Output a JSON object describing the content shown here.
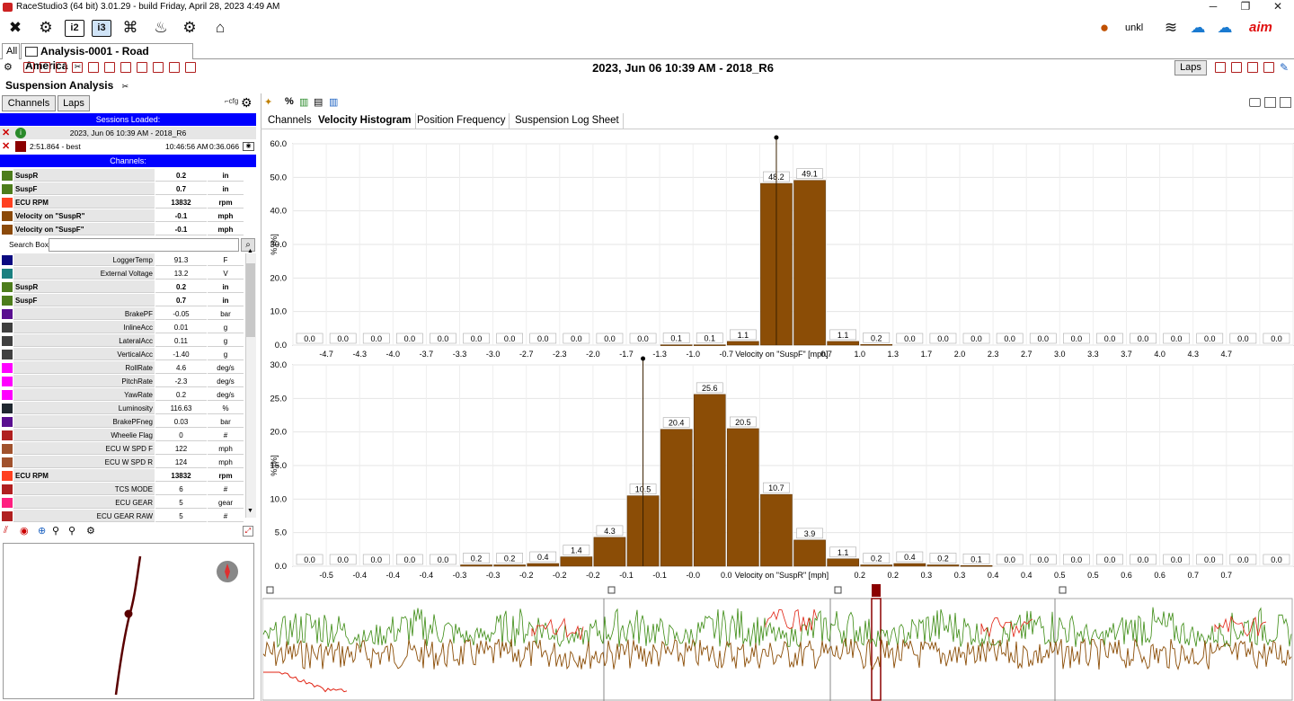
{
  "window": {
    "title": "RaceStudio3 (64 bit) 3.01.29 - build Friday, April 28, 2023 4:49 AM",
    "user": "unkl"
  },
  "tabs": {
    "all": "All",
    "analysis": "Analysis-0001 - Road America"
  },
  "header": {
    "session_title": "2023, Jun 06 10:39 AM - 2018_R6",
    "laps_button": "Laps"
  },
  "left": {
    "panel_title": "Suspension Analysis",
    "channels_btn": "Channels",
    "laps_btn": "Laps",
    "sessions_loaded": "Sessions Loaded:",
    "session_name": "2023, Jun 06 10:39 AM - 2018_R6",
    "lap_label": "2:51.864 - best",
    "lap_time": "10:46:56 AM",
    "lap_dur": "0:36.066",
    "channels_header": "Channels:",
    "search_label": "Search Box",
    "selected": [
      {
        "name": "SuspR",
        "value": "0.2",
        "unit": "in",
        "color": "#4d7d1c"
      },
      {
        "name": "SuspF",
        "value": "0.7",
        "unit": "in",
        "color": "#4d7d1c"
      },
      {
        "name": "ECU RPM",
        "value": "13832",
        "unit": "rpm",
        "color": "#ff4020"
      },
      {
        "name": "Velocity on \"SuspR\"",
        "value": "-0.1",
        "unit": "mph",
        "color": "#8b4a0a"
      },
      {
        "name": "Velocity on \"SuspF\"",
        "value": "-0.1",
        "unit": "mph",
        "color": "#8b4a0a"
      }
    ],
    "list": [
      {
        "name": "LoggerTemp",
        "value": "91.3",
        "unit": "F",
        "color": "#0a0a80",
        "bold": false
      },
      {
        "name": "External Voltage",
        "value": "13.2",
        "unit": "V",
        "color": "#1a8080",
        "bold": false
      },
      {
        "name": "SuspR",
        "value": "0.2",
        "unit": "in",
        "color": "#4d7d1c",
        "bold": true
      },
      {
        "name": "SuspF",
        "value": "0.7",
        "unit": "in",
        "color": "#4d7d1c",
        "bold": true
      },
      {
        "name": "BrakePF",
        "value": "-0.05",
        "unit": "bar",
        "color": "#5a1090",
        "bold": false
      },
      {
        "name": "InlineAcc",
        "value": "0.01",
        "unit": "g",
        "color": "#404040",
        "bold": false
      },
      {
        "name": "LateralAcc",
        "value": "0.11",
        "unit": "g",
        "color": "#404040",
        "bold": false
      },
      {
        "name": "VerticalAcc",
        "value": "-1.40",
        "unit": "g",
        "color": "#404040",
        "bold": false
      },
      {
        "name": "RollRate",
        "value": "4.6",
        "unit": "deg/s",
        "color": "#ff00ff",
        "bold": false
      },
      {
        "name": "PitchRate",
        "value": "-2.3",
        "unit": "deg/s",
        "color": "#ff00ff",
        "bold": false
      },
      {
        "name": "YawRate",
        "value": "0.2",
        "unit": "deg/s",
        "color": "#ff00ff",
        "bold": false
      },
      {
        "name": "Luminosity",
        "value": "116.63",
        "unit": "%",
        "color": "#202830",
        "bold": false
      },
      {
        "name": "BrakePFneg",
        "value": "0.03",
        "unit": "bar",
        "color": "#5a1090",
        "bold": false
      },
      {
        "name": "Wheelie Flag",
        "value": "0",
        "unit": "#",
        "color": "#b02020",
        "bold": false
      },
      {
        "name": "ECU W SPD F",
        "value": "122",
        "unit": "mph",
        "color": "#a0522d",
        "bold": false
      },
      {
        "name": "ECU W SPD R",
        "value": "124",
        "unit": "mph",
        "color": "#a0522d",
        "bold": false
      },
      {
        "name": "ECU RPM",
        "value": "13832",
        "unit": "rpm",
        "color": "#ff4020",
        "bold": true
      },
      {
        "name": "TCS MODE",
        "value": "6",
        "unit": "#",
        "color": "#b02020",
        "bold": false
      },
      {
        "name": "ECU GEAR",
        "value": "5",
        "unit": "gear",
        "color": "#ff2080",
        "bold": false
      },
      {
        "name": "ECU GEAR RAW",
        "value": "5",
        "unit": "#",
        "color": "#b02020",
        "bold": false
      }
    ]
  },
  "subtabs": [
    "Channels",
    "Velocity Histogram",
    "Position Frequency",
    "Suspension Log Sheet"
  ],
  "colors": {
    "bar": "#8b4d06",
    "accent_blue": "#0000ff",
    "trace_green": "#3a8a10",
    "trace_red": "#e02010"
  },
  "chart_data": [
    {
      "type": "bar",
      "xlabel": "Velocity on \"SuspF\" [mph]",
      "ylabel": "% [%]",
      "ylim": [
        0,
        60
      ],
      "yticks": [
        "0.0",
        "10.0",
        "20.0",
        "30.0",
        "40.0",
        "50.0",
        "60.0"
      ],
      "xticks": [
        "-4.7",
        "-4.3",
        "-4.0",
        "-3.7",
        "-3.3",
        "-3.0",
        "-2.7",
        "-2.3",
        "-2.0",
        "-1.7",
        "-1.3",
        "-1.0",
        "-0.7",
        "",
        "",
        "0.7",
        "1.0",
        "1.3",
        "1.7",
        "2.0",
        "2.3",
        "2.7",
        "3.0",
        "3.3",
        "3.7",
        "4.0",
        "4.3",
        "4.7"
      ],
      "values": [
        0.0,
        0.0,
        0.0,
        0.0,
        0.0,
        0.0,
        0.0,
        0.0,
        0.0,
        0.0,
        0.0,
        0.1,
        0.1,
        1.1,
        48.2,
        49.1,
        1.1,
        0.2,
        0.0,
        0.0,
        0.0,
        0.0,
        0.0,
        0.0,
        0.0,
        0.0,
        0.0,
        0.0,
        0.0,
        0.0
      ],
      "labels": [
        "0.0",
        "0.0",
        "0.0",
        "0.0",
        "0.0",
        "0.0",
        "0.0",
        "0.0",
        "0.0",
        "0.0",
        "0.0",
        "0.1",
        "0.1",
        "1.1",
        "48.2",
        "49.1",
        "1.1",
        "0.2",
        "0.0",
        "0.0",
        "0.0",
        "0.0",
        "0.0",
        "0.0",
        "0.0",
        "0.0",
        "0.0",
        "0.0",
        "0.0",
        "0.0"
      ],
      "marker_index": 14.5
    },
    {
      "type": "bar",
      "xlabel": "Velocity on \"SuspR\" [mph]",
      "ylabel": "% [%]",
      "ylim": [
        0,
        30
      ],
      "yticks": [
        "0.0",
        "5.0",
        "10.0",
        "15.0",
        "20.0",
        "25.0",
        "30.0"
      ],
      "xticks": [
        "-0.5",
        "-0.4",
        "-0.4",
        "-0.4",
        "-0.3",
        "-0.3",
        "-0.2",
        "-0.2",
        "-0.2",
        "-0.1",
        "-0.1",
        "-0.0",
        "0.0",
        "",
        "",
        "",
        "0.2",
        "0.2",
        "0.3",
        "0.3",
        "0.4",
        "0.4",
        "0.5",
        "0.5",
        "0.6",
        "0.6",
        "0.7",
        "0.7"
      ],
      "values": [
        0.0,
        0.0,
        0.0,
        0.0,
        0.0,
        0.2,
        0.2,
        0.4,
        1.4,
        4.3,
        10.5,
        20.4,
        25.6,
        20.5,
        10.7,
        3.9,
        1.1,
        0.2,
        0.4,
        0.2,
        0.1,
        0.0,
        0.0,
        0.0,
        0.0,
        0.0,
        0.0,
        0.0,
        0.0,
        0.0
      ],
      "labels": [
        "0.0",
        "0.0",
        "0.0",
        "0.0",
        "0.0",
        "0.2",
        "0.2",
        "0.4",
        "1.4",
        "4.3",
        "10.5",
        "20.4",
        "25.6",
        "20.5",
        "10.7",
        "3.9",
        "1.1",
        "0.2",
        "0.4",
        "0.2",
        "0.1",
        "0.0",
        "0.0",
        "0.0",
        "0.0",
        "0.0",
        "0.0",
        "0.0",
        "0.0",
        "0.0"
      ],
      "marker_index": 10.5
    }
  ]
}
